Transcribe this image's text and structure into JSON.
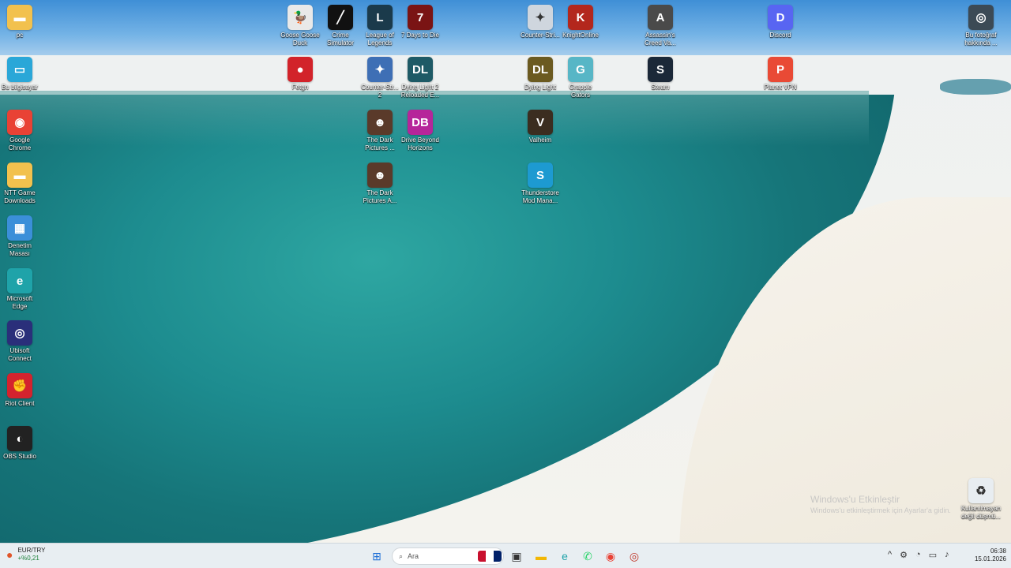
{
  "desktop": {
    "icons": [
      {
        "label": "pc",
        "color": "#f2c14e",
        "glyph": "▬",
        "left": 0
      },
      {
        "label": "Bu bilgisayar",
        "color": "#2aa7d8",
        "glyph": "▭"
      },
      {
        "label": "Google\nChrome",
        "color": "#e94235",
        "glyph": "◉"
      },
      {
        "label": "NTT Game\nDownloads",
        "color": "#f2c14e",
        "glyph": "▬"
      },
      {
        "label": "Denetim\nMasası",
        "color": "#3b8fd9",
        "glyph": "▦"
      },
      {
        "label": "Microsoft\nEdge",
        "color": "#1fa3a9",
        "glyph": "e"
      },
      {
        "label": "Ubisoft\nConnect",
        "color": "#2a2f7a",
        "glyph": "◎"
      },
      {
        "label": "Riot Client",
        "color": "#d4232e",
        "glyph": "✊"
      },
      {
        "label": "OBS Studio",
        "color": "#222222",
        "glyph": "◐"
      },
      {
        "label": "Goose Goose\nDuck",
        "color": "#e9e9e9",
        "glyph": "🦆"
      },
      {
        "label": "Fetgn",
        "color": "#d2232a",
        "glyph": "●"
      },
      {
        "label": "Crime\nSimulator",
        "color": "#111111",
        "glyph": "╱"
      },
      {
        "label": "League of\nLegends",
        "color": "#1b3a4b",
        "glyph": "L"
      },
      {
        "label": "Counter-Str...\n2",
        "color": "#3e6fb5",
        "glyph": "✦"
      },
      {
        "label": "The Dark\nPictures ...",
        "color": "#5a3a2a",
        "glyph": "☻"
      },
      {
        "label": "The Dark\nPictures A...",
        "color": "#5a3a2a",
        "glyph": "☻"
      },
      {
        "label": "7 Days to Die",
        "color": "#7a1414",
        "glyph": "7"
      },
      {
        "label": "Dying Light 2\nReloaded E...",
        "color": "#1e5a66",
        "glyph": "DL"
      },
      {
        "label": "Drive Beyond\nHorizons",
        "color": "#b6259a",
        "glyph": "DB"
      },
      {
        "label": "Counter-Stri...",
        "color": "#cfd6de",
        "glyph": "✦"
      },
      {
        "label": "Dying Light",
        "color": "#6b5a20",
        "glyph": "DL"
      },
      {
        "label": "Valheim",
        "color": "#3b2d20",
        "glyph": "V"
      },
      {
        "label": "Thunderstore\nMod Mana...",
        "color": "#1d9ad1",
        "glyph": "S"
      },
      {
        "label": "KnightOnline",
        "color": "#b3271d",
        "glyph": "K"
      },
      {
        "label": "Grapple\nGators",
        "color": "#57b6c6",
        "glyph": "G"
      },
      {
        "label": "Assassin's\nCreed Va...",
        "color": "#4a4a4a",
        "glyph": "A"
      },
      {
        "label": "Steam",
        "color": "#1b2838",
        "glyph": "S"
      },
      {
        "label": "Discord",
        "color": "#5865f2",
        "glyph": "D"
      },
      {
        "label": "Planet VPN",
        "color": "#e94a35",
        "glyph": "P"
      },
      {
        "label": "Bu fotoğraf\nhakkında ...",
        "color": "#3c4a55",
        "glyph": "◎"
      },
      {
        "label": "Kullanılmayan\ndeğil düşmü...",
        "color": "#e8edf1",
        "glyph": "♻"
      }
    ],
    "watermark": {
      "title": "Windows'u Etkinleştir",
      "subtitle": "Windows'u etkinleştirmek için Ayarlar'a gidin."
    }
  },
  "taskbar": {
    "weather": {
      "symbol": "EUR/TRY",
      "change": "+%0,21"
    },
    "search_placeholder": "Ara",
    "apps": [
      {
        "name": "windows-start",
        "glyph": "⊞",
        "color": "#1f6fd6"
      },
      {
        "name": "search",
        "glyph": "⌕",
        "color": "#333333"
      },
      {
        "name": "task-view",
        "glyph": "▣",
        "color": "#333333"
      },
      {
        "name": "file-explorer",
        "glyph": "▬",
        "color": "#f2b705"
      },
      {
        "name": "edge",
        "glyph": "e",
        "color": "#1fa3a9"
      },
      {
        "name": "whatsapp",
        "glyph": "✆",
        "color": "#25d366"
      },
      {
        "name": "chrome",
        "glyph": "◉",
        "color": "#e94235"
      },
      {
        "name": "opera-gx",
        "glyph": "◎",
        "color": "#c0392b"
      }
    ],
    "tray_icons": [
      "^",
      "⚙",
      "◔",
      "▭",
      "♪"
    ],
    "clock": {
      "time": "06:38",
      "date": "15.01.2026"
    }
  }
}
